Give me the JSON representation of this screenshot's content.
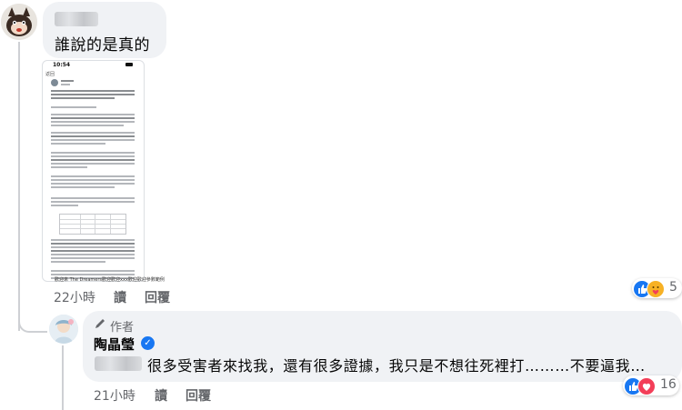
{
  "comment": {
    "text": "誰說的是真的",
    "meta": {
      "time": "22小時",
      "read_label": "讀",
      "reply_label": "回覆"
    },
    "reactions": {
      "count": "5",
      "icons": [
        "like-icon",
        "care-icon"
      ]
    },
    "attachment": {
      "status_time": "10:54",
      "nav_text": "返回 ",
      "caption": "歡迎來 The Dreamers歡迎歡迎xxx歡迎歡迎參數範例"
    }
  },
  "reply": {
    "badge_label": "作者",
    "author_name": "陶晶瑩",
    "text": "很多受害者來找我，還有很多證據，我只是不想往死裡打………不要逼我…",
    "meta": {
      "time": "21小時",
      "read_label": "讀",
      "reply_label": "回覆"
    },
    "reactions": {
      "count": "16",
      "icons": [
        "like-icon",
        "love-icon"
      ]
    }
  },
  "colors": {
    "bubble": "#f0f2f5",
    "meta_text": "#65676b",
    "like": "#1877f2",
    "love": "#f33e58",
    "care": "#f7b125"
  }
}
